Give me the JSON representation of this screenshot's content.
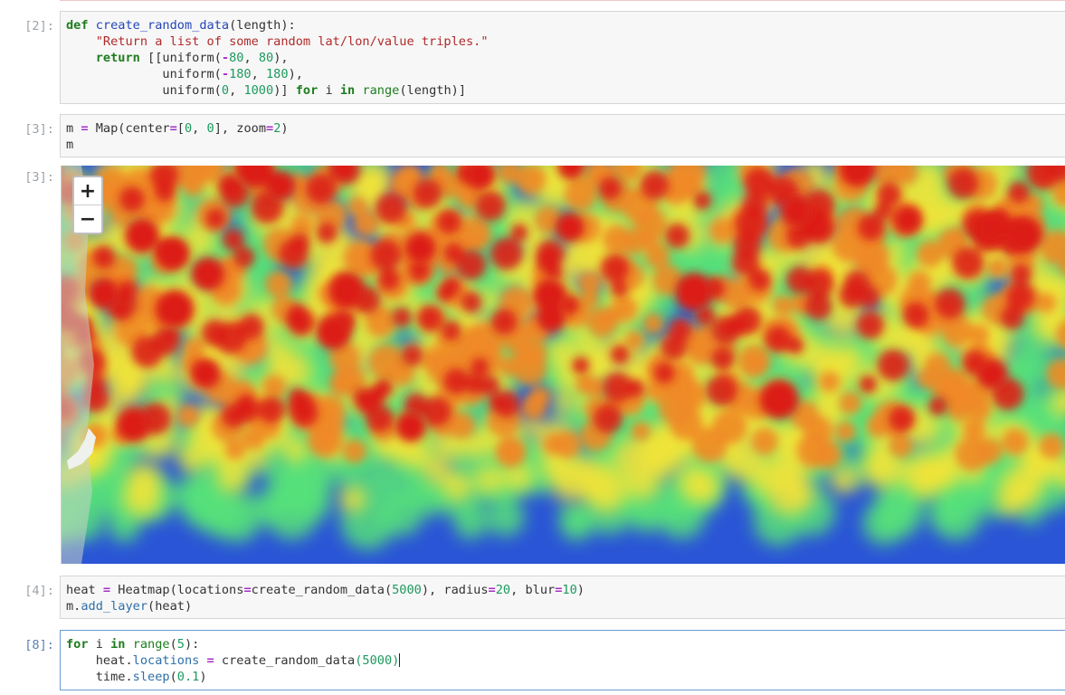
{
  "cells": [
    {
      "prompt": "[2]:",
      "lines": [
        [
          [
            "kw",
            "def"
          ],
          [
            "t",
            " "
          ],
          [
            "fn",
            "create_random_data"
          ],
          [
            "t",
            "(length):"
          ]
        ],
        [
          [
            "t",
            "    "
          ],
          [
            "str",
            "\"Return a list of some random lat/lon/value triples.\""
          ]
        ],
        [
          [
            "t",
            "    "
          ],
          [
            "kw",
            "return"
          ],
          [
            "t",
            " [[uniform("
          ],
          [
            "op",
            "-"
          ],
          [
            "num",
            "80"
          ],
          [
            "t",
            ", "
          ],
          [
            "num",
            "80"
          ],
          [
            "t",
            "),"
          ]
        ],
        [
          [
            "t",
            "             uniform("
          ],
          [
            "op",
            "-"
          ],
          [
            "num",
            "180"
          ],
          [
            "t",
            ", "
          ],
          [
            "num",
            "180"
          ],
          [
            "t",
            "),"
          ]
        ],
        [
          [
            "t",
            "             uniform("
          ],
          [
            "num",
            "0"
          ],
          [
            "t",
            ", "
          ],
          [
            "num",
            "1000"
          ],
          [
            "t",
            ")] "
          ],
          [
            "kw",
            "for"
          ],
          [
            "t",
            " i "
          ],
          [
            "kw",
            "in"
          ],
          [
            "t",
            " "
          ],
          [
            "bi",
            "range"
          ],
          [
            "t",
            "(length)]"
          ]
        ]
      ]
    },
    {
      "prompt": "[3]:",
      "lines": [
        [
          [
            "t",
            "m "
          ],
          [
            "op",
            "="
          ],
          [
            "t",
            " Map(center"
          ],
          [
            "op",
            "="
          ],
          [
            "t",
            "["
          ],
          [
            "num",
            "0"
          ],
          [
            "t",
            ", "
          ],
          [
            "num",
            "0"
          ],
          [
            "t",
            "], zoom"
          ],
          [
            "op",
            "="
          ],
          [
            "num",
            "2"
          ],
          [
            "t",
            ")"
          ]
        ],
        [
          [
            "t",
            "m"
          ]
        ]
      ]
    },
    {
      "prompt": "[4]:",
      "lines": [
        [
          [
            "t",
            "heat "
          ],
          [
            "op",
            "="
          ],
          [
            "t",
            " Heatmap(locations"
          ],
          [
            "op",
            "="
          ],
          [
            "t",
            "create_random_data("
          ],
          [
            "num",
            "5000"
          ],
          [
            "t",
            "), radius"
          ],
          [
            "op",
            "="
          ],
          [
            "num",
            "20"
          ],
          [
            "t",
            ", blur"
          ],
          [
            "op",
            "="
          ],
          [
            "num",
            "10"
          ],
          [
            "t",
            ")"
          ]
        ],
        [
          [
            "t",
            "m."
          ],
          [
            "attr",
            "add_layer"
          ],
          [
            "t",
            "(heat)"
          ]
        ]
      ]
    },
    {
      "prompt": "[8]:",
      "lines": [
        [
          [
            "kw",
            "for"
          ],
          [
            "t",
            " i "
          ],
          [
            "kw",
            "in"
          ],
          [
            "t",
            " "
          ],
          [
            "bi",
            "range"
          ],
          [
            "t",
            "("
          ],
          [
            "num",
            "5"
          ],
          [
            "t",
            "):"
          ]
        ],
        [
          [
            "t",
            "    heat."
          ],
          [
            "attr",
            "locations"
          ],
          [
            "t",
            " "
          ],
          [
            "op",
            "="
          ],
          [
            "t",
            " create_random_data"
          ],
          [
            "num",
            "(5000)"
          ]
        ],
        [
          [
            "t",
            "    time."
          ],
          [
            "attr",
            "sleep"
          ],
          [
            "t",
            "("
          ],
          [
            "num",
            "0.1"
          ],
          [
            "t",
            ")"
          ]
        ]
      ]
    }
  ],
  "output": {
    "prompt": "[3]:",
    "zoom_in_label": "+",
    "zoom_out_label": "−"
  },
  "colors": {
    "heat_low": "#2a55d6",
    "heat_mid": "#56e07a",
    "heat_yellow": "#f0e43a",
    "heat_orange": "#f08a26",
    "heat_high": "#dc1e14"
  }
}
